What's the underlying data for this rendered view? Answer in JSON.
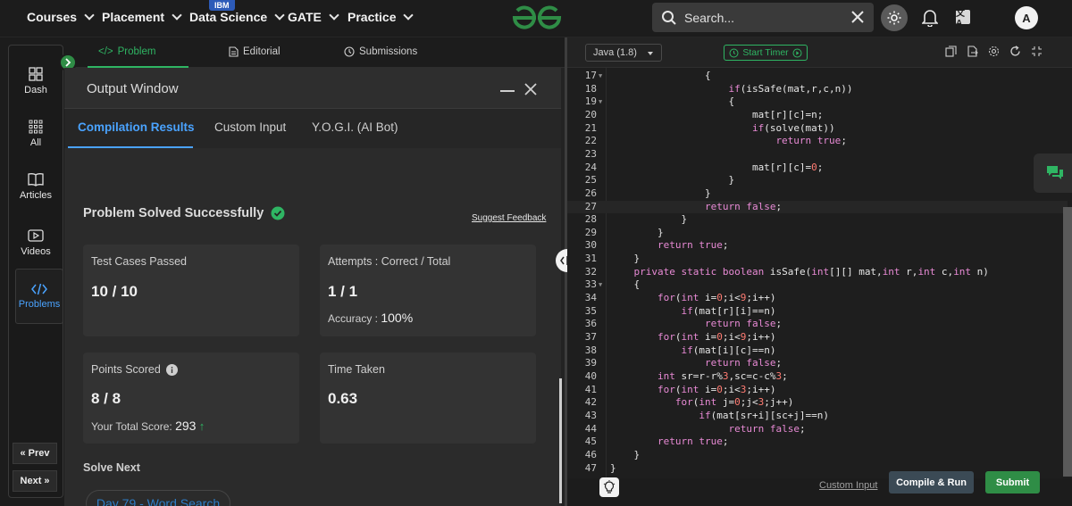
{
  "nav": {
    "items": [
      {
        "label": "Courses"
      },
      {
        "label": "Placement"
      },
      {
        "label": "Data Science"
      },
      {
        "label": "GATE"
      },
      {
        "label": "Practice"
      }
    ],
    "ibm_badge": "IBM",
    "search_placeholder": "Search...",
    "translate_icon_text": "文A",
    "avatar_letter": "A"
  },
  "sidebar": {
    "items": [
      {
        "label": "Dash",
        "icon": "dashboard-icon"
      },
      {
        "label": "All",
        "icon": "grid-icon"
      },
      {
        "label": "Articles",
        "icon": "book-icon"
      },
      {
        "label": "Videos",
        "icon": "video-icon"
      },
      {
        "label": "Problems",
        "icon": "code-icon"
      }
    ],
    "prev_label": "Prev",
    "next_label": "Next"
  },
  "tabs": {
    "problem": "Problem",
    "editorial": "Editorial",
    "submissions": "Submissions"
  },
  "output_window": {
    "title": "Output Window",
    "tabs": [
      "Compilation Results",
      "Custom Input",
      "Y.O.G.I. (AI Bot)"
    ],
    "result_title": "Problem Solved Successfully",
    "feedback_link": "Suggest Feedback",
    "test_cases_label": "Test Cases Passed",
    "test_cases_value": "10 / 10",
    "attempts_label": "Attempts : Correct / Total",
    "attempts_value": "1 / 1",
    "accuracy_label": "Accuracy :",
    "accuracy_value": "100%",
    "points_label": "Points Scored",
    "points_value": "8 / 8",
    "total_score_label": "Your Total Score:",
    "total_score_value": "293",
    "time_label": "Time Taken",
    "time_value": "0.63",
    "solve_next_label": "Solve Next",
    "next_problem": "Day 79 - Word Search"
  },
  "editor": {
    "language": "Java (1.8)",
    "timer_label": "Start Timer",
    "custom_input_link": "Custom Input",
    "compile_run_label": "Compile & Run",
    "submit_label": "Submit",
    "lines": [
      {
        "n": "17",
        "fold": true,
        "html": "                <span>{</span>"
      },
      {
        "n": "18",
        "fold": false,
        "html": "                    <span class=\"kw\">if</span>(isSafe(mat,r,c,n))"
      },
      {
        "n": "19",
        "fold": true,
        "html": "                    {"
      },
      {
        "n": "20",
        "fold": false,
        "html": "                        mat[r][c]=n;"
      },
      {
        "n": "21",
        "fold": false,
        "html": "                        <span class=\"kw\">if</span>(solve(mat))"
      },
      {
        "n": "22",
        "fold": false,
        "html": "                            <span class=\"kw\">return</span> <span class=\"bool\">true</span>;"
      },
      {
        "n": "23",
        "fold": false,
        "html": ""
      },
      {
        "n": "24",
        "fold": false,
        "html": "                        mat[r][c]=<span class=\"num\">0</span>;"
      },
      {
        "n": "25",
        "fold": false,
        "html": "                    }"
      },
      {
        "n": "26",
        "fold": false,
        "html": "                }"
      },
      {
        "n": "27",
        "fold": false,
        "html": "                <span class=\"kw\">return</span> <span class=\"bool\">false</span>;",
        "hl": true
      },
      {
        "n": "28",
        "fold": false,
        "html": "            }"
      },
      {
        "n": "29",
        "fold": false,
        "html": "        }"
      },
      {
        "n": "30",
        "fold": false,
        "html": "        <span class=\"kw\">return</span> <span class=\"bool\">true</span>;"
      },
      {
        "n": "31",
        "fold": false,
        "html": "    }"
      },
      {
        "n": "32",
        "fold": false,
        "html": "    <span class=\"kw\">private</span> <span class=\"kw\">static</span> <span class=\"tp\">boolean</span> isSafe(<span class=\"tp\">int</span>[][] mat,<span class=\"tp\">int</span> r,<span class=\"tp\">int</span> c,<span class=\"tp\">int</span> n)"
      },
      {
        "n": "33",
        "fold": true,
        "html": "    {"
      },
      {
        "n": "34",
        "fold": false,
        "html": "        <span class=\"kw\">for</span>(<span class=\"tp\">int</span> i=<span class=\"num\">0</span>;i&lt;<span class=\"num\">9</span>;i++)"
      },
      {
        "n": "35",
        "fold": false,
        "html": "            <span class=\"kw\">if</span>(mat[r][i]==n)"
      },
      {
        "n": "36",
        "fold": false,
        "html": "                <span class=\"kw\">return</span> <span class=\"bool\">false</span>;"
      },
      {
        "n": "37",
        "fold": false,
        "html": "        <span class=\"kw\">for</span>(<span class=\"tp\">int</span> i=<span class=\"num\">0</span>;i&lt;<span class=\"num\">9</span>;i++)"
      },
      {
        "n": "38",
        "fold": false,
        "html": "            <span class=\"kw\">if</span>(mat[i][c]==n)"
      },
      {
        "n": "39",
        "fold": false,
        "html": "                <span class=\"kw\">return</span> <span class=\"bool\">false</span>;"
      },
      {
        "n": "40",
        "fold": false,
        "html": "        <span class=\"tp\">int</span> sr=r-r%<span class=\"num\">3</span>,sc=c-c%<span class=\"num\">3</span>;"
      },
      {
        "n": "41",
        "fold": false,
        "html": "        <span class=\"kw\">for</span>(<span class=\"tp\">int</span> i=<span class=\"num\">0</span>;i&lt;<span class=\"num\">3</span>;i++)"
      },
      {
        "n": "42",
        "fold": false,
        "html": "           <span class=\"kw\">for</span>(<span class=\"tp\">int</span> j=<span class=\"num\">0</span>;j&lt;<span class=\"num\">3</span>;j++)"
      },
      {
        "n": "43",
        "fold": false,
        "html": "               <span class=\"kw\">if</span>(mat[sr+i][sc+j]==n)"
      },
      {
        "n": "44",
        "fold": false,
        "html": "                    <span class=\"kw\">return</span> <span class=\"bool\">false</span>;"
      },
      {
        "n": "45",
        "fold": false,
        "html": "        <span class=\"kw\">return</span> <span class=\"bool\">true</span>;"
      },
      {
        "n": "46",
        "fold": false,
        "html": "    }"
      },
      {
        "n": "47",
        "fold": false,
        "html": "}"
      }
    ]
  },
  "colors": {
    "accent_green": "#2fb563",
    "accent_blue": "#4aa3ff",
    "submit_green": "#2f8d46"
  }
}
